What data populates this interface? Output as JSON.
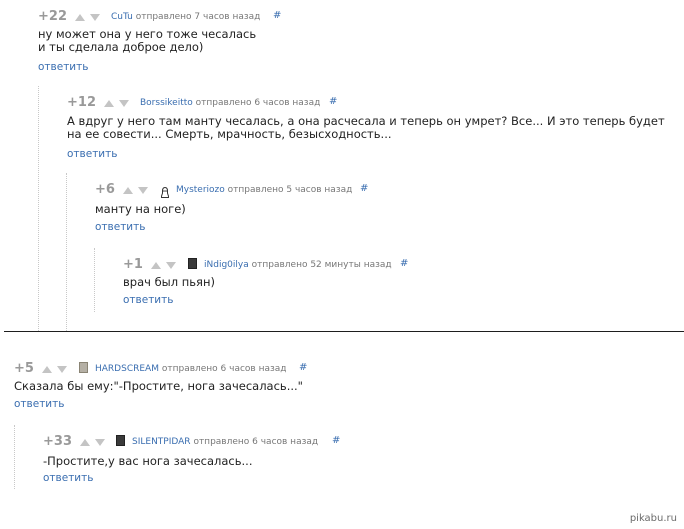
{
  "comments": [
    {
      "rating": "+22",
      "author": "CuTu",
      "time": "отправлено 7 часов назад",
      "hash": "#",
      "text": "ну может она у него тоже чесалась\nи ты сделала доброе дело)",
      "reply": "ответить"
    },
    {
      "rating": "+12",
      "author": "Borssikeitto",
      "time": "отправлено 6 часов назад",
      "hash": "#",
      "text": "А вдруг у него там манту чесалась, а она расчесала и теперь он умрет? Все... И это теперь будет\nна ее совести... Смерть, мрачность, безысходность...",
      "reply": "ответить"
    },
    {
      "rating": "+6",
      "author": "Mysteriozo",
      "time": "отправлено 5 часов назад",
      "hash": "#",
      "text": "манту на ноге)",
      "reply": "ответить"
    },
    {
      "rating": "+1",
      "author": "iNdig0ilya",
      "time": "отправлено 52 минуты назад",
      "hash": "#",
      "text": "врач был пьян)",
      "reply": "ответить"
    },
    {
      "rating": "+5",
      "author": "HARDSCREAM",
      "time": "отправлено 6 часов назад",
      "hash": "#",
      "text": "Сказала бы ему:\"-Простите, нога зачесалась...\"",
      "reply": "ответить"
    },
    {
      "rating": "+33",
      "author": "SILENTPIDAR",
      "time": "отправлено 6 часов назад",
      "hash": "#",
      "text": "-Простите,у вас нога зачесалась...",
      "reply": "ответить"
    }
  ],
  "watermark": "pikabu.ru",
  "colors": {
    "link": "#3a6eb0",
    "rating": "#999999",
    "arrow": "#c4c4c4",
    "divider": "#1e1e1e"
  }
}
